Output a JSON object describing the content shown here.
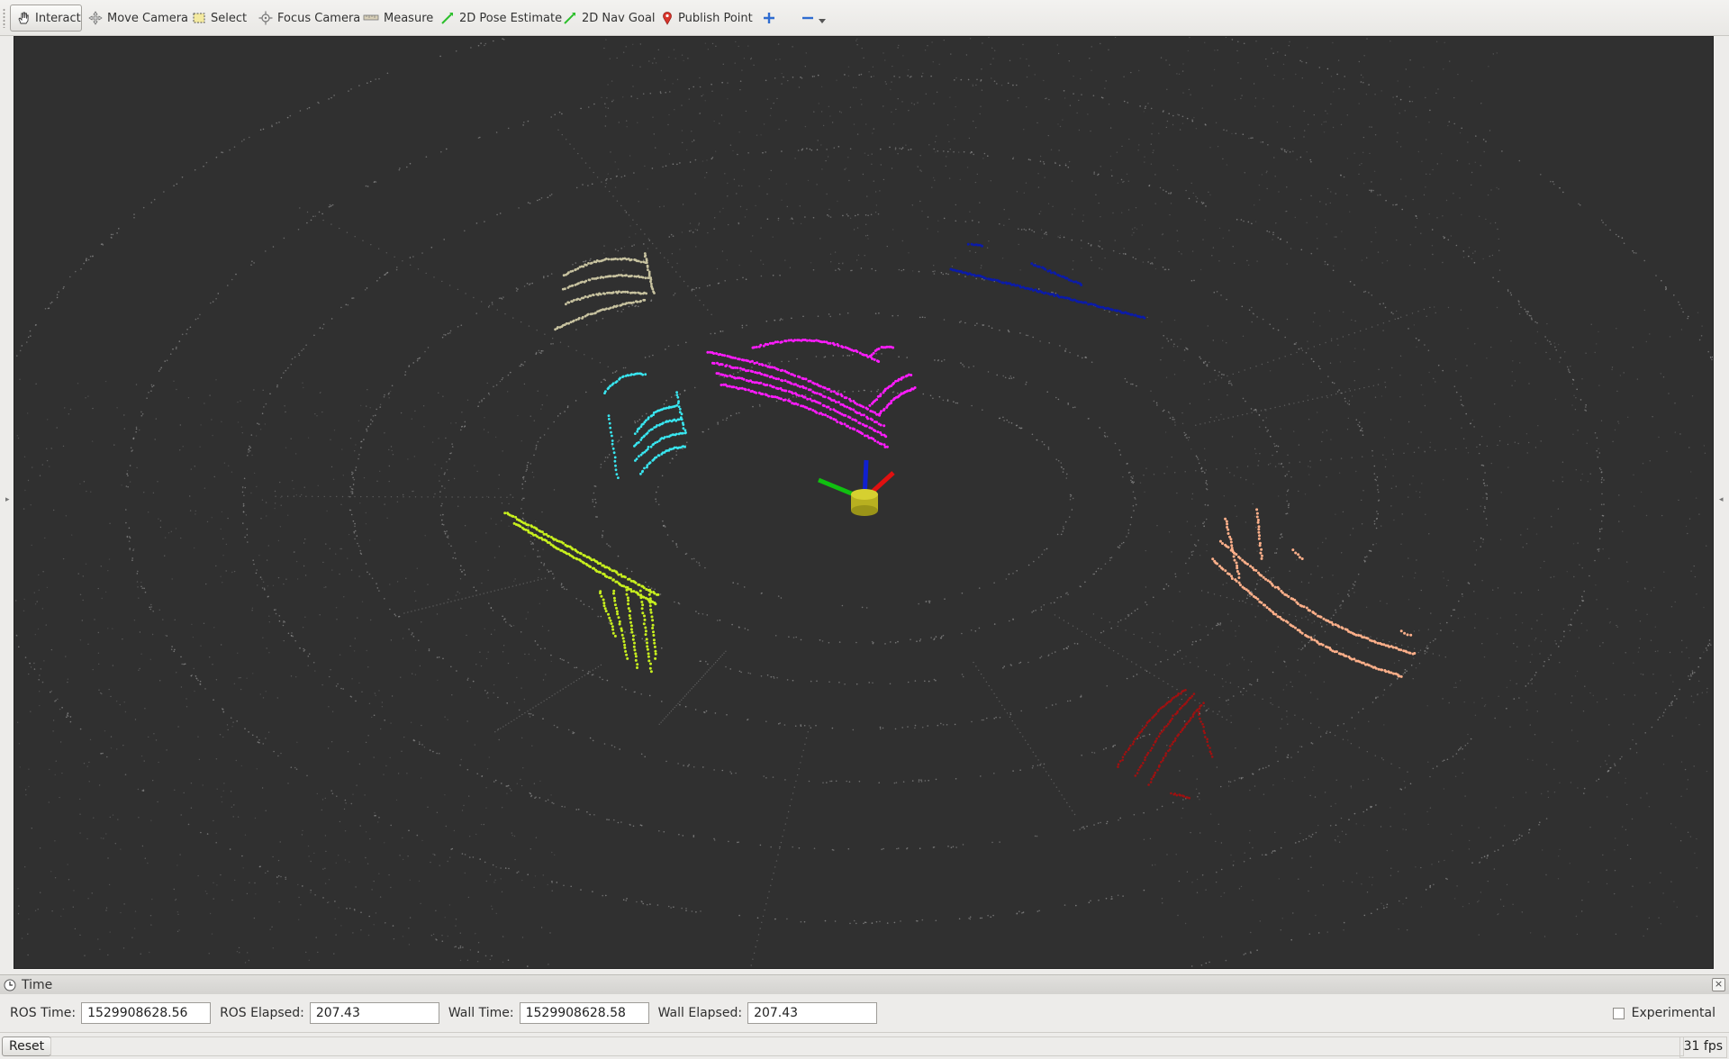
{
  "toolbar": {
    "interact": "Interact",
    "move_camera": "Move Camera",
    "select": "Select",
    "focus_camera": "Focus Camera",
    "measure": "Measure",
    "pose_estimate": "2D Pose Estimate",
    "nav_goal": "2D Nav Goal",
    "publish_point": "Publish Point",
    "add_tool_icon": "plus-icon",
    "remove_tool_icon": "minus-icon"
  },
  "viewport": {
    "background": "#303030",
    "point_cloud_colors": {
      "ground": "#8a8a8a",
      "beige": "#c8c3a0",
      "magenta": "#ff1cff",
      "cyan": "#39e6f0",
      "navy": "#0b1ba8",
      "yellow_green": "#c8f01e",
      "peach": "#ffb08a",
      "dark_red": "#a01010"
    },
    "axes_colors": {
      "x": "#e01010",
      "y": "#10c010",
      "z": "#1020d0",
      "base": "#c8c020"
    }
  },
  "time_panel": {
    "title": "Time",
    "ros_time_label": "ROS Time:",
    "ros_time": "1529908628.56",
    "ros_elapsed_label": "ROS Elapsed:",
    "ros_elapsed": "207.43",
    "wall_time_label": "Wall Time:",
    "wall_time": "1529908628.58",
    "wall_elapsed_label": "Wall Elapsed:",
    "wall_elapsed": "207.43",
    "experimental_label": "Experimental",
    "experimental_checked": false
  },
  "status_bar": {
    "reset_label": "Reset",
    "fps": "31 fps"
  }
}
